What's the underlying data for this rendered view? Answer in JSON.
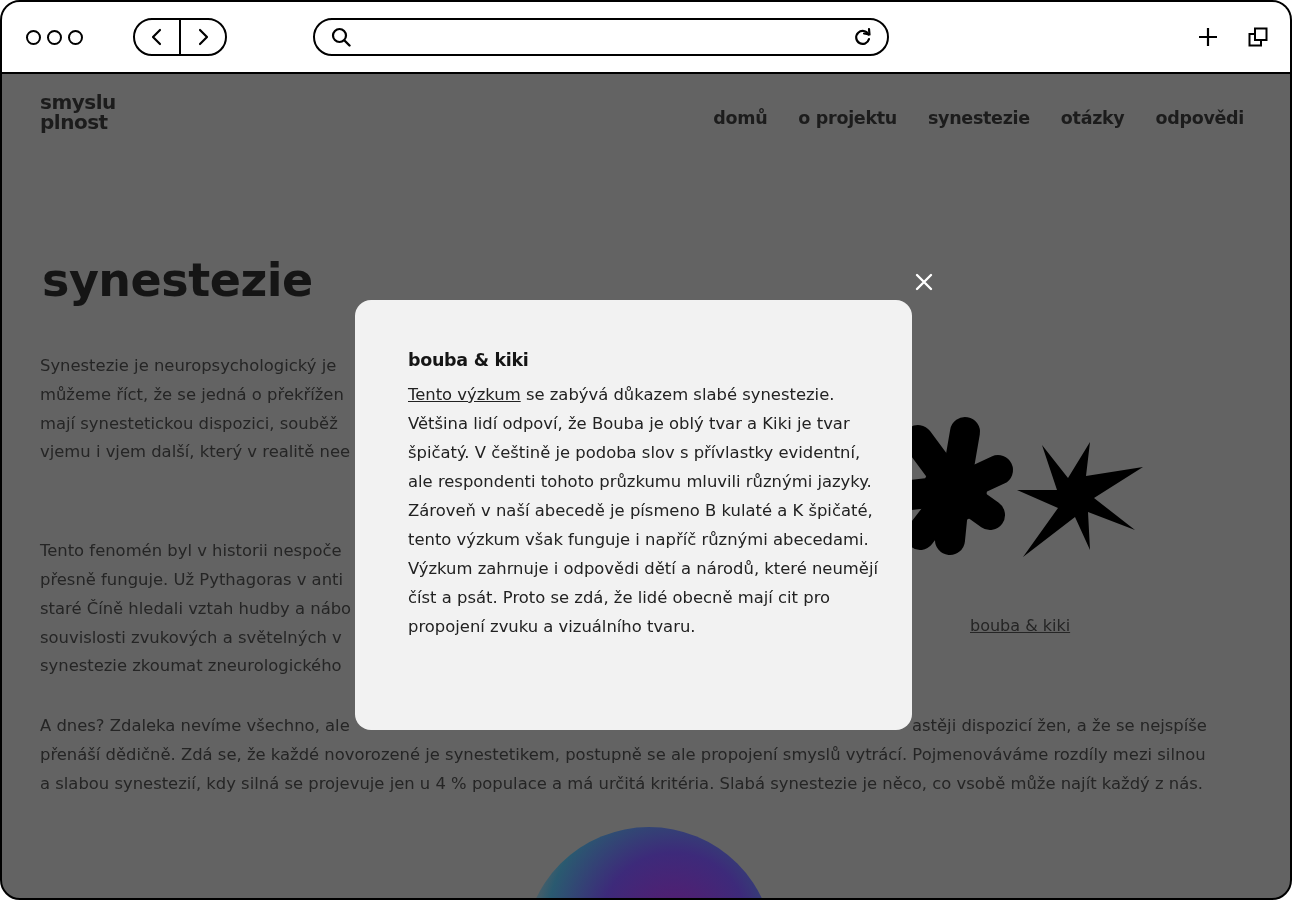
{
  "logo": [
    "smyslu",
    "plnost"
  ],
  "nav": [
    "domů",
    "o projektu",
    "synestezie",
    "otázky",
    "odpovědi"
  ],
  "heading": "synestezie",
  "paragraph_1": [
    "Synestezie je neuropsychologický je",
    "můžeme říct, že se jedná o překřížen",
    "mají synestetickou dispozici, souběž",
    "vjemu i vjem další, který v realitě nee"
  ],
  "paragraph_2": [
    "Tento fenomén byl v historii nespoče",
    "přesně funguje. Už Pythagoras v anti",
    "staré Číně hledali vztah hudby a nábo",
    "souvislosti zvukových a světelných v",
    "synestezie zkoumat zneurologického"
  ],
  "paragraph_3": {
    "line_1_left": "A dnes? Zdaleka nevíme všechno, ale",
    "line_1_right": "astěji dispozicí žen, a že se nejspíše",
    "lines": [
      "přenáší dědičně. Zdá se, že každé novorozené je synestetikem, postupně se ale propojení smyslů vytrácí. Pojmenováváme rozdíly mezi silnou",
      "a slabou synestezií, kdy silná se projevuje jen u 4 % populace a má určitá kritéria. Slabá synestezie je něco, co vsobě může najít každý z nás."
    ]
  },
  "figure_caption": "bouba & kiki",
  "modal": {
    "title": "bouba & kiki",
    "link": "Tento výzkum",
    "text": " se zabývá důkazem slabé synestezie. Většina lidí odpoví, že Bouba je oblý tvar a Kiki je tvar špičatý. V češtině je podoba slov s přívlastky evidentní, ale respondenti tohoto průzkumu mluvili různými jazyky. Zároveň v naší abecedě  je písmeno B kulaté a K špičaté, tento výzkum však funguje i napříč různými abecedami. Výzkum zahrnuje i odpovědi dětí a národů, které neumějí číst a psát. Proto se zdá, že lidé obecně mají cit pro propojení zvuku a vizuálního tvaru."
  }
}
